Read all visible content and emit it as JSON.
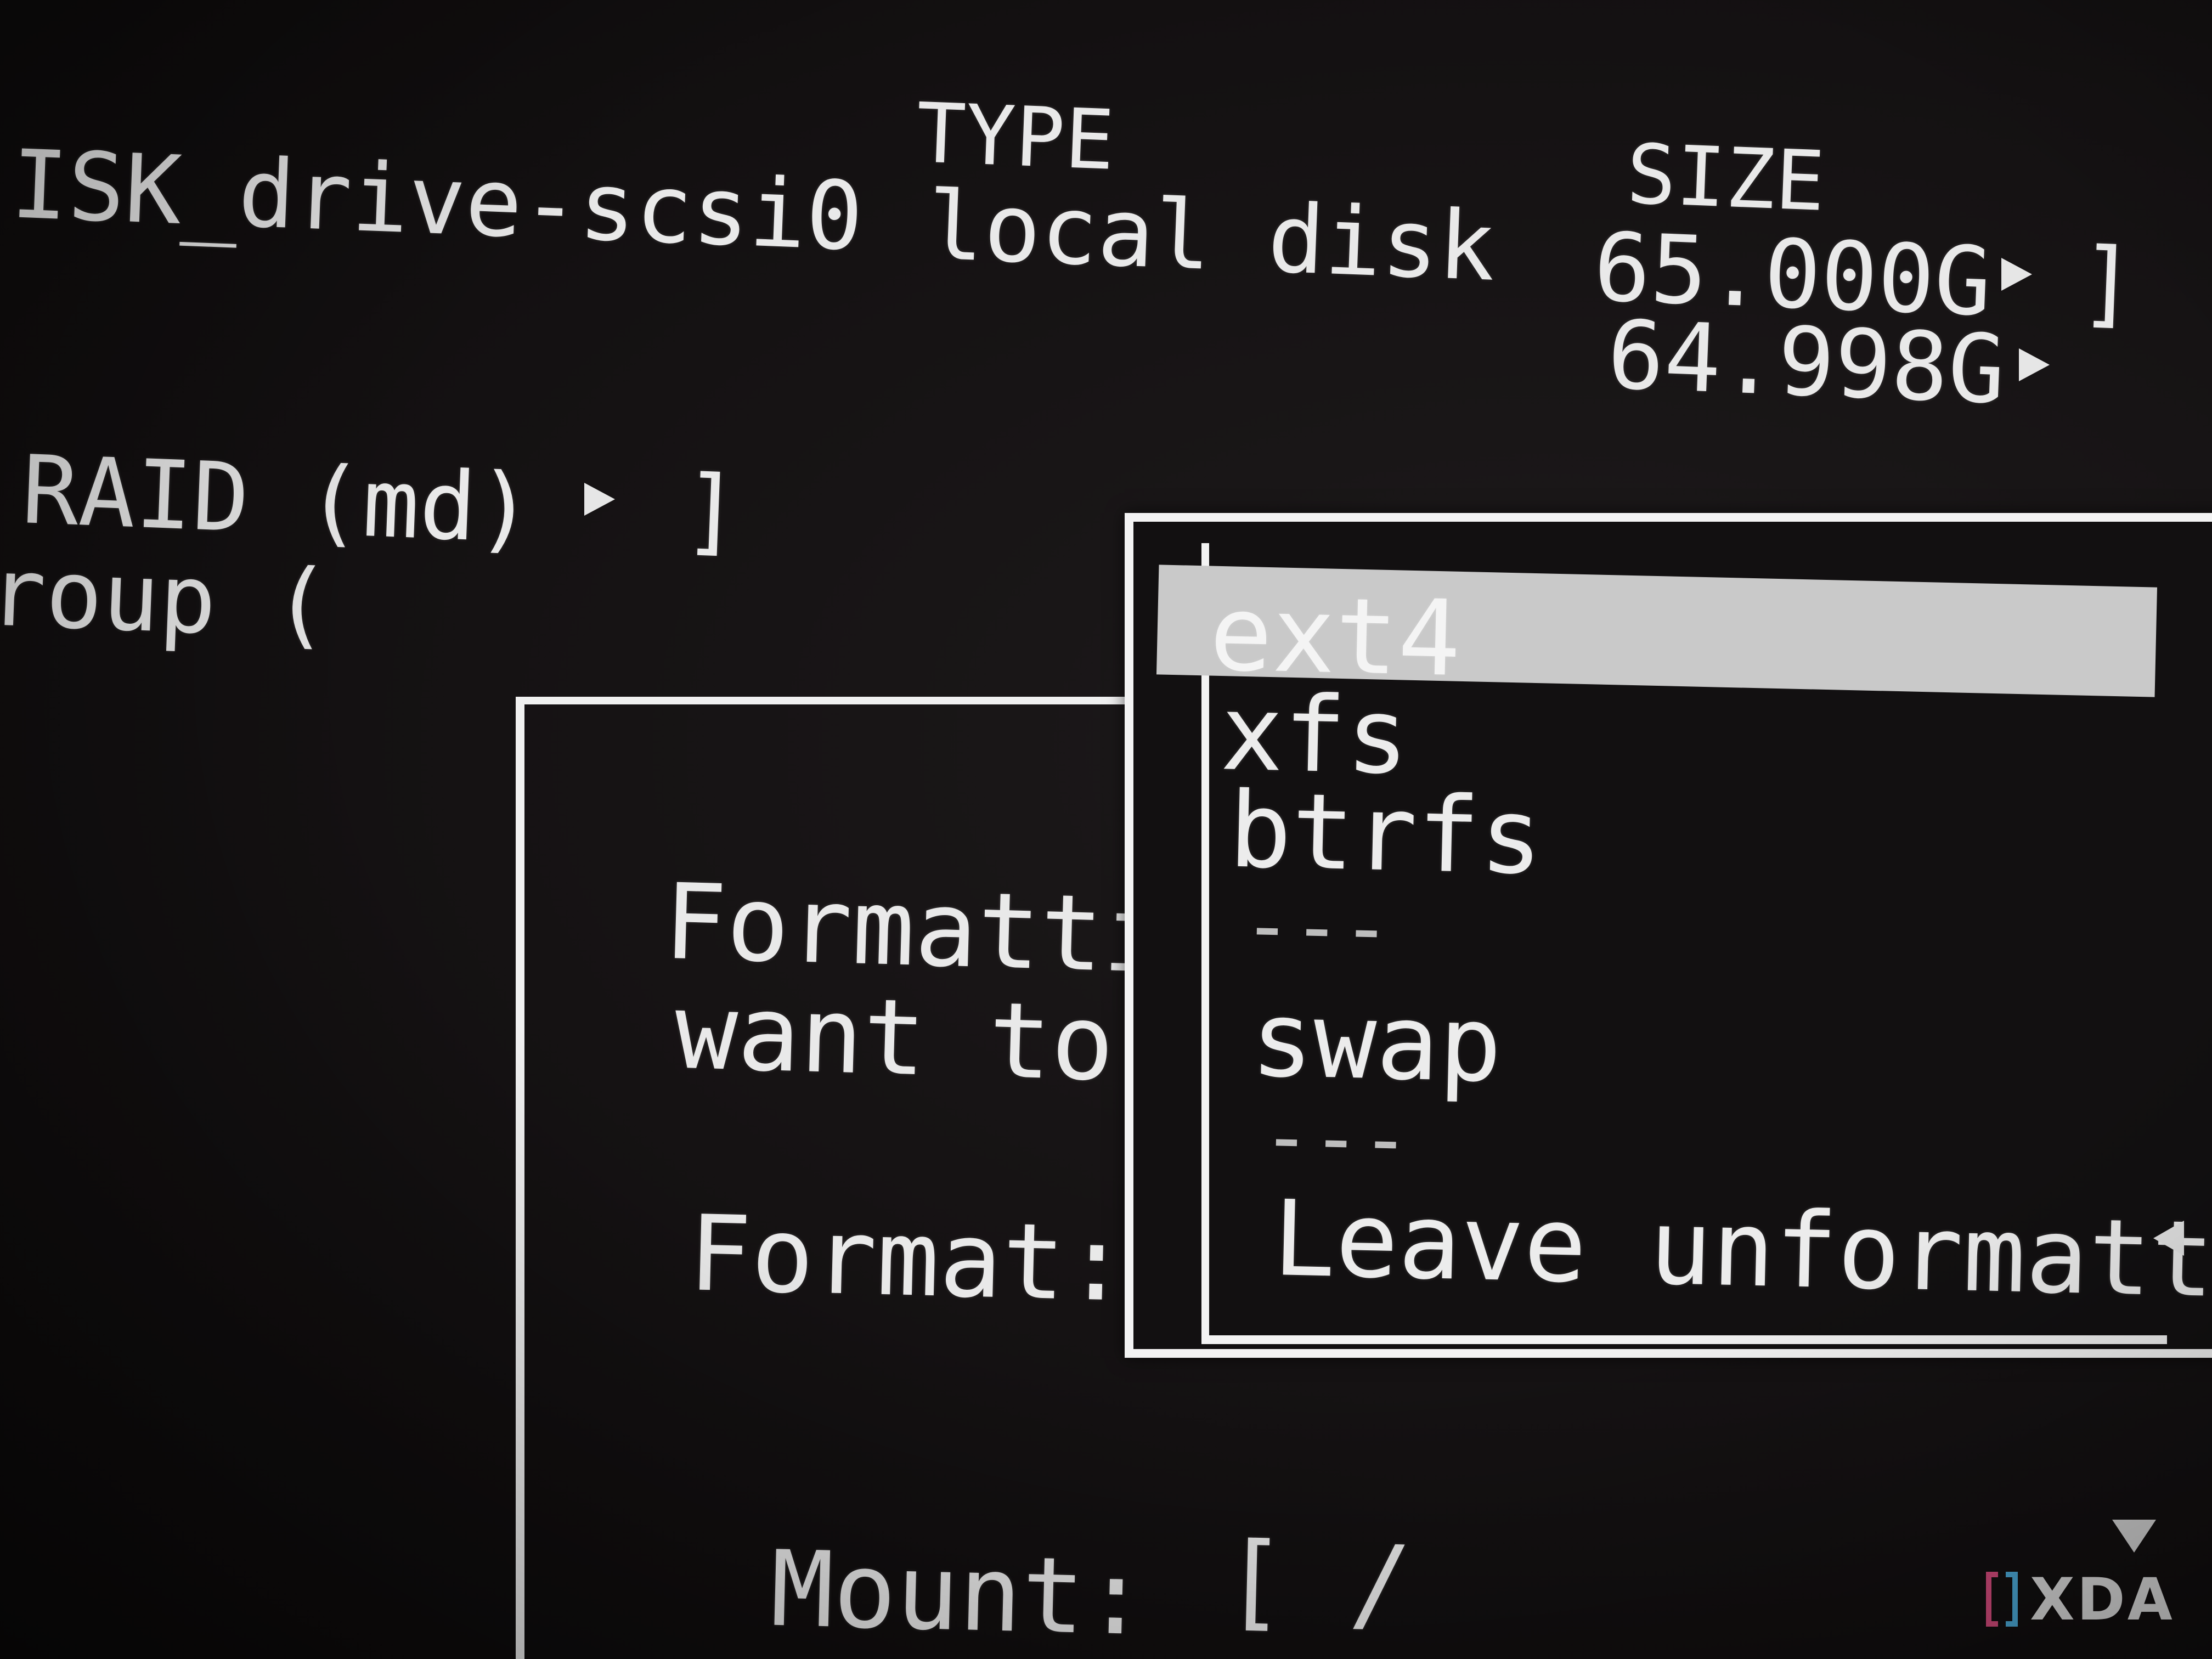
{
  "table": {
    "headers": {
      "type": "TYPE",
      "size": "SIZE"
    },
    "device_row": {
      "name": "ISK_drive-scsi0",
      "type": "local disk",
      "size": "65.000G",
      "bracket": "]"
    },
    "partition_row": {
      "size": "64.998G"
    },
    "raid_row": {
      "label": "RAID (md)",
      "bracket": "]"
    },
    "group_row": {
      "label": "roup ("
    }
  },
  "dialog": {
    "message_line1": "Formattin",
    "message_line2": "want to a",
    "format_label": "Format:",
    "mount_label": "Mount:",
    "mount_value": "[ /"
  },
  "format_dropdown": {
    "options": [
      {
        "label": "ext4",
        "selected": true
      },
      {
        "label": "xfs",
        "selected": false
      },
      {
        "label": "btrfs",
        "selected": false
      },
      {
        "label": "---",
        "separator": true
      },
      {
        "label": "swap",
        "selected": false
      },
      {
        "label": "---",
        "separator": true
      },
      {
        "label": "Leave unformatted",
        "selected": false
      }
    ]
  },
  "watermark": {
    "brand": "XDA"
  },
  "colors": {
    "background": "#141112",
    "foreground": "#e9e9e9",
    "selection": "#c9c9c9",
    "border": "#f0f0f0"
  },
  "icons": {
    "row_expand": "triangle-right-icon",
    "current_value": "triangle-left-icon",
    "scroll": "triangle-down-icon"
  }
}
